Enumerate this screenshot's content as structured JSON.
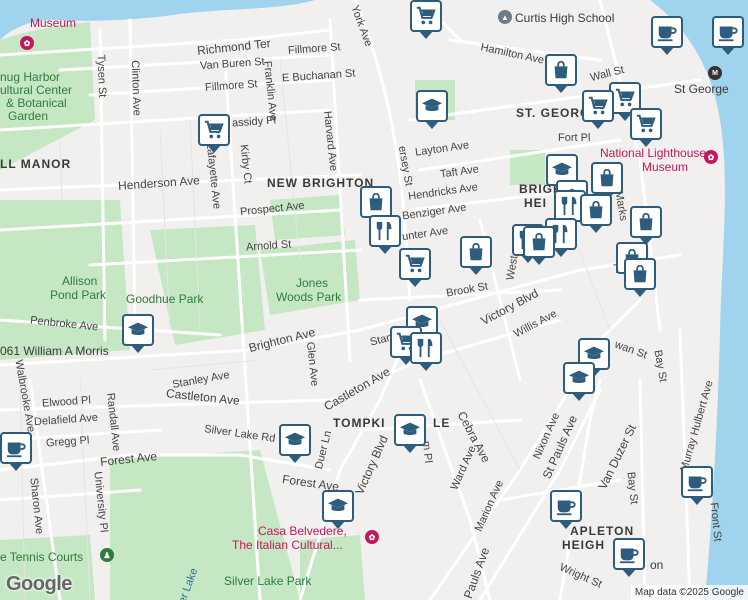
{
  "labels": {
    "museum_top": "Museum",
    "snug_harbor_1": "nug Harbor",
    "snug_harbor_2": "ultural Center",
    "snug_harbor_3": "& Botanical",
    "snug_harbor_4": "Garden",
    "curtis": "Curtis High School",
    "richmond_ter": "Richmond Ter",
    "van_buren": "Van Buren St",
    "fillmore1": "Fillmore St",
    "fillmore2": "Fillmore St",
    "e_buchanan": "E Buchanan St",
    "york": "York Ave",
    "hamilton": "Hamilton Ave",
    "wall": "Wall St",
    "st_george_area": "ST. GEORG",
    "st_george": "St George",
    "fort_pl": "Fort Pl",
    "tysen": "Tysen St",
    "clinton": "Clinton Ave",
    "franklin": "Franklin Ave",
    "harvard": "Harvard Ave",
    "cassidy": "assidy Pl",
    "kirby": "Kirby Ct",
    "lafayette": "Lafayette Ave",
    "layton": "Layton Ave",
    "taft": "Taft Ave",
    "hendricks": "Hendricks Ave",
    "lighthouse1": "National Lighthouse",
    "lighthouse2": "Museum",
    "manor": "LL MANOR",
    "henderson": "Henderson Ave",
    "new_brighton": "NEW BRIGHTON",
    "brighton_h": "BRIGH",
    "brighton_h2": "HEI",
    "prospect": "Prospect Ave",
    "benziger": "Benziger Ave",
    "hunter": "unter Ave",
    "arnold": "Arnold St",
    "jersey": "ersey St",
    "allison1": "Allison",
    "allison2": "Pond Park",
    "jones1": "Jones",
    "jones2": "Woods Park",
    "goodhue": "Goodhue Park",
    "tompkinsville": "Tomp",
    "brook": "Brook St",
    "victory1": "Victory Blvd",
    "willis": "Willis Ave",
    "penbroke": "Penbroke Ave",
    "brighton_ave": "Brighton Ave",
    "morris": "061 William A Morris",
    "glen": "Glen Ave",
    "stanley": "Stanley Ave",
    "stan": "Stan",
    "castleton1": "Castleton Ave",
    "castleton2": "Castleton Ave",
    "bay": "Bay St",
    "walbrooke": "Walbrooke Ave",
    "elwood": "Elwood Pl",
    "delafield": "Delafield Ave",
    "randall": "Randall Ave",
    "gregg": "Gregg Pl",
    "silver_lake_rd": "Silver Lake Rd",
    "tompkinsville_area": "TOMPKI",
    "tompkinsville_area2": "LE",
    "cebra": "Cebra Ave",
    "nixon": "Nixon Ave",
    "st_pauls": "St Pauls Ave",
    "van_duzer": "Van Duzer St",
    "murray": "Murray Hulbert Ave",
    "forest1": "Forest Ave",
    "forest2": "Forest Ave",
    "duer": "Duer Ln",
    "victory2": "Victory Blvd",
    "ward": "Ward Ave",
    "hamm": "m Pl",
    "sharon": "Sharon Ave",
    "university": "University Pl",
    "marion": "Marion Ave",
    "stapleton": "APLETON",
    "stapleton2": "HEIGH",
    "bay2": "Bay St",
    "front": "Front St",
    "wright": "Wright St",
    "casa1": "Casa Belvedere,",
    "casa2": "The Italian Cultural...",
    "tennis": "e Tennis Courts",
    "silver_lake": "Silver Lake Park",
    "silver_lake_water": "er Lake",
    "pauls_bottom": "Pauls Ave",
    "owan": "wan St",
    "on": "on",
    "marks": "Marks",
    "west": "West"
  },
  "google": "Google",
  "attribution": "Map data ©2025 Google",
  "colors": {
    "water": "#9fd3ee",
    "park": "#c5e7c4",
    "marker_border": "#2d5c7d",
    "marker_icon": "#2d5c7d"
  }
}
